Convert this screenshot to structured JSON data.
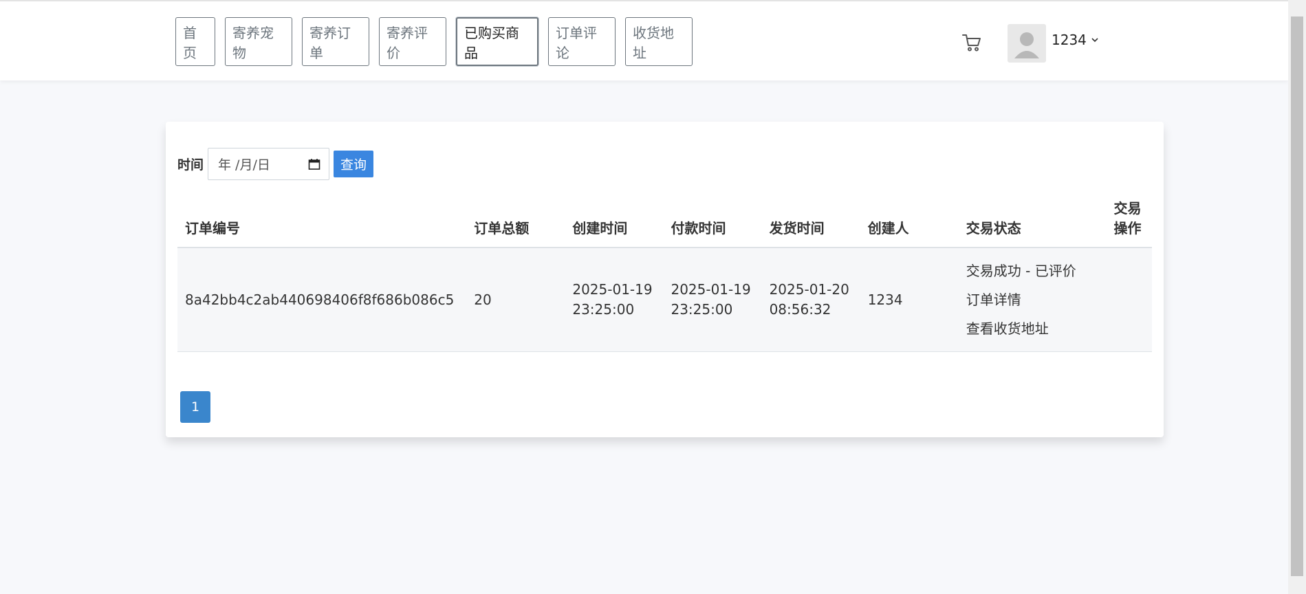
{
  "nav": {
    "items": [
      {
        "label": "首页",
        "width": 58
      },
      {
        "label": "寄养宠物",
        "width": 98
      },
      {
        "label": "寄养订单",
        "width": 98
      },
      {
        "label": "寄养评价",
        "width": 98
      },
      {
        "label": "已购买商品",
        "width": 120
      },
      {
        "label": "订单评论",
        "width": 98
      },
      {
        "label": "收货地址",
        "width": 98
      }
    ],
    "active": "已购买商品"
  },
  "user": {
    "name": "1234"
  },
  "icons": {
    "cart": "cart-icon",
    "avatar": "user-silhouette-icon",
    "dropdown": "chevron-down-icon",
    "calendar": "calendar-icon"
  },
  "search": {
    "label": "时间",
    "date_placeholder": "年 /月/日",
    "button": "查询"
  },
  "table": {
    "headers": [
      "订单编号",
      "订单总额",
      "创建时间",
      "付款时间",
      "发货时间",
      "创建人",
      "交易状态",
      "交易操作"
    ],
    "rows": [
      {
        "order_no": "8a42bb4c2ab440698406f8f686b086c5",
        "total": "20",
        "created": "2025-01-19 23:25:00",
        "paid": "2025-01-19 23:25:00",
        "shipped": "2025-01-20 08:56:32",
        "creator": "1234",
        "status": "交易成功 - 已评价",
        "detail_link": "订单详情",
        "address_link": "查看收货地址",
        "action": ""
      }
    ]
  },
  "pagination": {
    "current": "1"
  },
  "colors": {
    "primary": "#3a86e0",
    "page": "#3a86cc",
    "background": "#f7f8fb"
  }
}
